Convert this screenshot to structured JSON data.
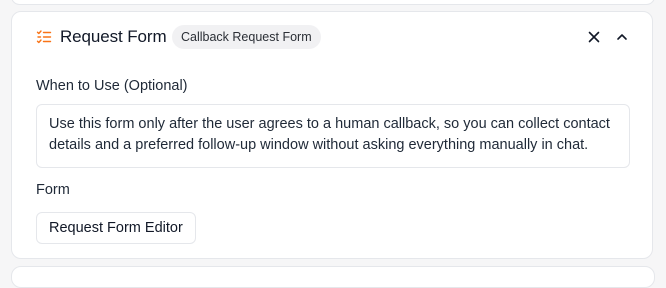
{
  "card": {
    "title": "Request Form",
    "badge": "Callback Request Form",
    "icon": "list-check-icon",
    "accent_color": "#f97316"
  },
  "when_to_use": {
    "label": "When to Use (Optional)",
    "value": "Use this form only after the user agrees to a human callback, so you can collect contact details and a preferred follow-up window without asking everything manually in chat."
  },
  "form": {
    "label": "Form",
    "editor_button": "Request Form Editor"
  }
}
